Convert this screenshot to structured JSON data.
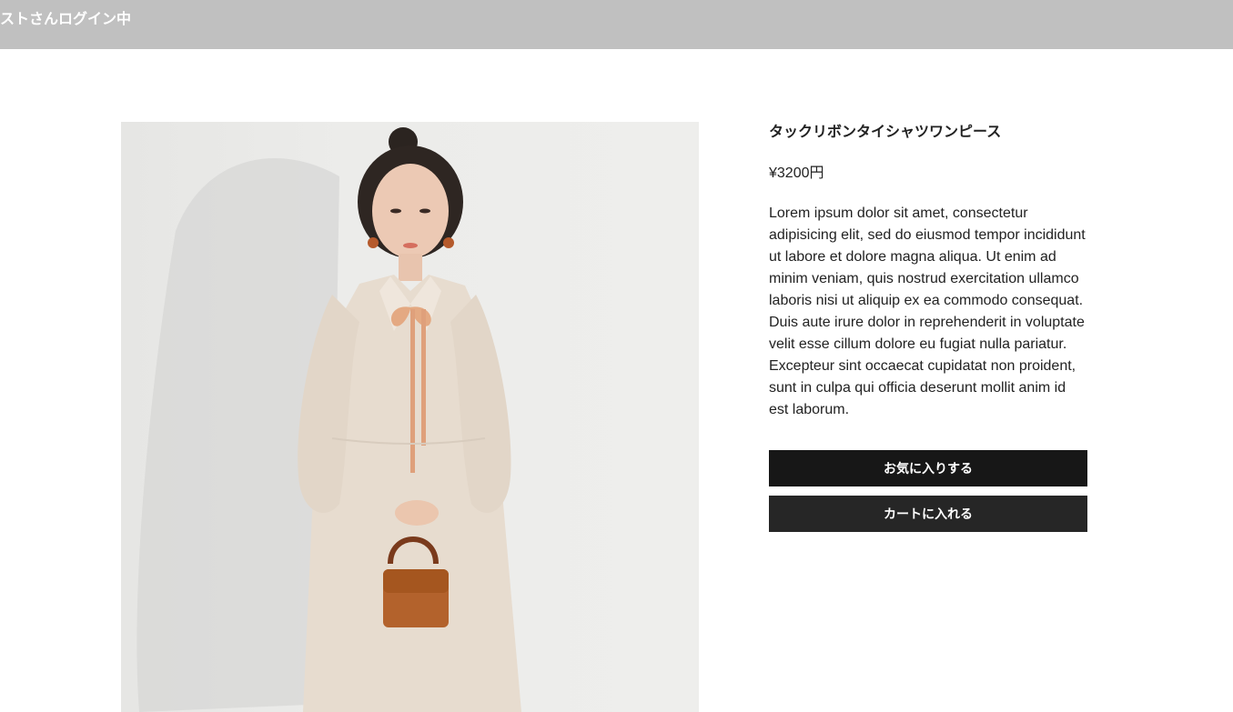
{
  "header": {
    "login_status": "ストさんログイン中"
  },
  "product": {
    "name": "タックリボンタイシャツワンピース",
    "price": "¥3200円",
    "description": "Lorem ipsum dolor sit amet, consectetur adipisicing elit, sed do eiusmod tempor incididunt ut labore et dolore magna aliqua. Ut enim ad minim veniam, quis nostrud exercitation ullamco laboris nisi ut aliquip ex ea commodo consequat. Duis aute irure dolor in reprehenderit in voluptate velit esse cillum dolore eu fugiat nulla pariatur. Excepteur sint occaecat cupidatat non proident, sunt in culpa qui officia deserunt mollit anim id est laborum."
  },
  "actions": {
    "favorite_label": "お気に入りする",
    "cart_label": "カートに入れる"
  },
  "colors": {
    "header_bg": "#c0c0c0",
    "favorite_button_bg": "#171717",
    "cart_button_bg": "#262626"
  }
}
